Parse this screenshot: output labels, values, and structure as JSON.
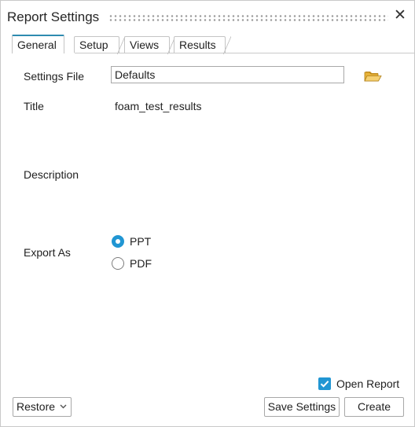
{
  "window": {
    "title": "Report Settings"
  },
  "tabs": [
    {
      "label": "General",
      "active": true
    },
    {
      "label": "Setup",
      "active": false
    },
    {
      "label": "Views",
      "active": false
    },
    {
      "label": "Results",
      "active": false
    }
  ],
  "form": {
    "settings_file": {
      "label": "Settings File",
      "value": "Defaults"
    },
    "title": {
      "label": "Title",
      "value": "foam_test_results"
    },
    "description": {
      "label": "Description"
    },
    "export_as": {
      "label": "Export As",
      "options": [
        {
          "label": "PPT",
          "selected": true
        },
        {
          "label": "PDF",
          "selected": false
        }
      ]
    }
  },
  "footer": {
    "open_report": {
      "label": "Open Report",
      "checked": true
    },
    "restore_label": "Restore",
    "save_label": "Save Settings",
    "create_label": "Create"
  },
  "colors": {
    "accent": "#2196d3",
    "tab_accent": "#2e8bb0",
    "folder": "#e8b33a"
  },
  "icons": {
    "close": "close-icon",
    "folder": "folder-open-icon",
    "dropdown": "chevron-down-icon",
    "check": "checkmark-icon"
  }
}
